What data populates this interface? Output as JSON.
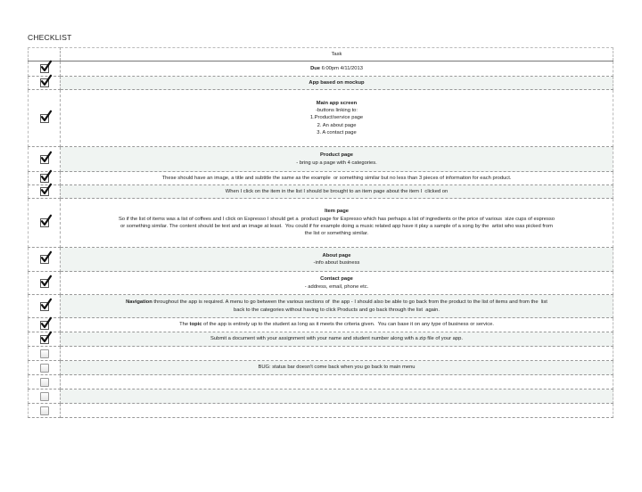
{
  "title": "CHECKLIST",
  "header": {
    "task": "Task"
  },
  "rows": [
    {
      "checked": true,
      "shaded": false,
      "h": 17,
      "lines": [
        {
          "bold": "Due",
          "text": " 6:00pm 4/11/2013"
        }
      ]
    },
    {
      "checked": true,
      "shaded": true,
      "h": 15,
      "lines": [
        {
          "bold": "App based on mockup",
          "text": ""
        }
      ]
    },
    {
      "checked": true,
      "shaded": false,
      "h": 64,
      "lines": [
        {
          "bold": "Main app screen",
          "text": ""
        },
        {
          "bold": "",
          "text": "-buttons linking to:"
        },
        {
          "bold": "",
          "text": "1.Product/service page"
        },
        {
          "bold": "",
          "text": "2. An about page"
        },
        {
          "bold": "",
          "text": "3. A contact page"
        }
      ]
    },
    {
      "checked": true,
      "shaded": true,
      "h": 28,
      "lines": [
        {
          "bold": "Product page",
          "text": ""
        },
        {
          "bold": "",
          "text": "- bring up a page with 4 categories."
        }
      ]
    },
    {
      "checked": true,
      "shaded": false,
      "h": 15,
      "lines": [
        {
          "bold": "",
          "text": "These should have an image, a title and subtitle the same as the example  or something similar but no less than 3 pieces of information for each product."
        }
      ]
    },
    {
      "checked": true,
      "shaded": true,
      "h": 15,
      "lines": [
        {
          "bold": "",
          "text": "When I click on the item in the list I should be brought to an item page about the item I  clicked on"
        }
      ]
    },
    {
      "checked": true,
      "shaded": false,
      "h": 55,
      "lines": [
        {
          "bold": "Item page",
          "text": ""
        },
        {
          "bold": "",
          "text": "So if the list of items was a list of coffees and I click on Espresso I should get a  product page for Espresso which has perhaps a list of ingredients or the price of various  size cups of espresso"
        },
        {
          "bold": "",
          "text": "or something similar. The content should be text and an image at least.  You could if for example doing a music related app have it play a sample of a song by the  artist who was picked from"
        },
        {
          "bold": "",
          "text": "the list or something similar."
        }
      ]
    },
    {
      "checked": true,
      "shaded": true,
      "h": 27,
      "lines": [
        {
          "bold": "About page",
          "text": ""
        },
        {
          "bold": "",
          "text": "-info about business"
        }
      ]
    },
    {
      "checked": true,
      "shaded": false,
      "h": 26,
      "lines": [
        {
          "bold": "Contact page",
          "text": ""
        },
        {
          "bold": "",
          "text": "- address, email, phone etc."
        }
      ]
    },
    {
      "checked": true,
      "shaded": true,
      "h": 26,
      "lines": [
        {
          "bold": "Navigation",
          "text": " throughout the app is required. A menu to go between the various sections of  the app - I should also be able to go back from the product to the list of items and from the  list"
        },
        {
          "bold": "",
          "text": "back to the categories without having to click Products and go back through the list  again."
        }
      ]
    },
    {
      "checked": true,
      "shaded": false,
      "h": 16,
      "lines": [
        {
          "pre": "The ",
          "bold": "topic",
          "text": " of the app is entirely up to the student as long as it meets the criteria given.  You can base it on any type of business or service."
        }
      ]
    },
    {
      "checked": true,
      "shaded": true,
      "h": 16,
      "lines": [
        {
          "bold": "",
          "text": "Submit a document with your assignment with your name and student number along with a zip file of your app."
        }
      ]
    },
    {
      "checked": false,
      "shaded": false,
      "h": 16,
      "lines": [
        {
          "bold": "",
          "text": ""
        }
      ]
    },
    {
      "checked": false,
      "shaded": true,
      "h": 16,
      "lines": [
        {
          "bold": "",
          "text": "BUG: status bar doesn't come back when you go back to main menu"
        }
      ]
    },
    {
      "checked": false,
      "shaded": false,
      "h": 16,
      "lines": [
        {
          "bold": "",
          "text": ""
        }
      ]
    },
    {
      "checked": false,
      "shaded": true,
      "h": 16,
      "lines": [
        {
          "bold": "",
          "text": ""
        }
      ]
    },
    {
      "checked": false,
      "shaded": false,
      "h": 16,
      "lines": [
        {
          "bold": "",
          "text": ""
        }
      ]
    }
  ]
}
